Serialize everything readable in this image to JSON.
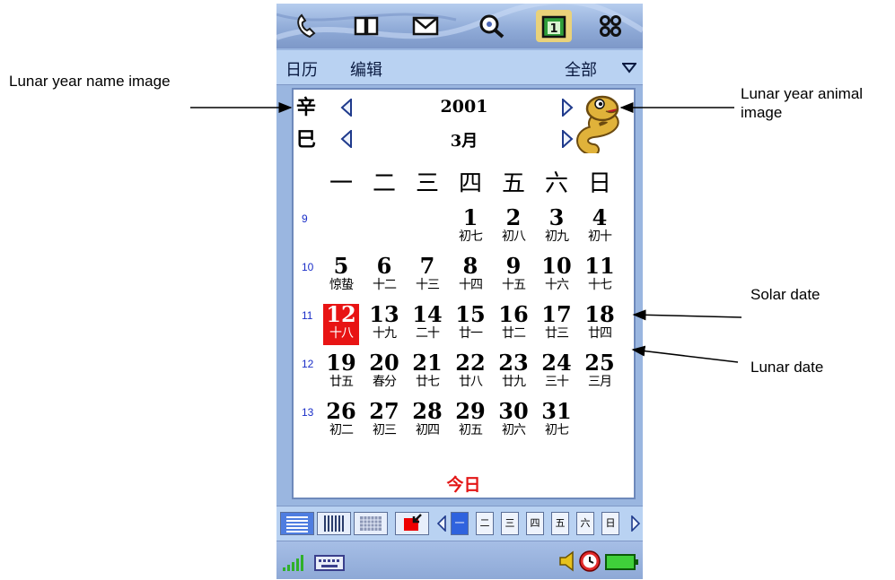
{
  "annotations": {
    "lunar_year_name": "Lunar year name image",
    "lunar_year_animal": "Lunar year animal image",
    "solar_date": "Solar date",
    "lunar_date": "Lunar date"
  },
  "topbar": {
    "icons": [
      "phone-icon",
      "contacts-book-icon",
      "messages-envelope-icon",
      "web-search-icon",
      "calendar-icon",
      "apps-grid-icon"
    ],
    "calendar_icon_digit": "1"
  },
  "menu": {
    "calendar": "日历",
    "edit": "编辑",
    "filter": "全部"
  },
  "year_panel": {
    "stem": "辛",
    "branch": "巳",
    "year": "2001",
    "month": "3月",
    "animal_icon": "snake-icon"
  },
  "weekdays": [
    "一",
    "二",
    "三",
    "四",
    "五",
    "六",
    "日"
  ],
  "weeks": [
    {
      "num": "9",
      "days": [
        null,
        null,
        null,
        {
          "s": "1",
          "l": "初七"
        },
        {
          "s": "2",
          "l": "初八"
        },
        {
          "s": "3",
          "l": "初九"
        },
        {
          "s": "4",
          "l": "初十"
        }
      ]
    },
    {
      "num": "10",
      "days": [
        {
          "s": "5",
          "l": "惊蛰"
        },
        {
          "s": "6",
          "l": "十二"
        },
        {
          "s": "7",
          "l": "十三"
        },
        {
          "s": "8",
          "l": "十四"
        },
        {
          "s": "9",
          "l": "十五"
        },
        {
          "s": "10",
          "l": "十六"
        },
        {
          "s": "11",
          "l": "十七"
        }
      ]
    },
    {
      "num": "11",
      "days": [
        {
          "s": "12",
          "l": "十八",
          "today": true
        },
        {
          "s": "13",
          "l": "十九"
        },
        {
          "s": "14",
          "l": "二十"
        },
        {
          "s": "15",
          "l": "廿一"
        },
        {
          "s": "16",
          "l": "廿二"
        },
        {
          "s": "17",
          "l": "廿三"
        },
        {
          "s": "18",
          "l": "廿四"
        }
      ]
    },
    {
      "num": "12",
      "days": [
        {
          "s": "19",
          "l": "廿五"
        },
        {
          "s": "20",
          "l": "春分"
        },
        {
          "s": "21",
          "l": "廿七"
        },
        {
          "s": "22",
          "l": "廿八"
        },
        {
          "s": "23",
          "l": "廿九"
        },
        {
          "s": "24",
          "l": "三十"
        },
        {
          "s": "25",
          "l": "三月"
        }
      ]
    },
    {
      "num": "13",
      "days": [
        {
          "s": "26",
          "l": "初二"
        },
        {
          "s": "27",
          "l": "初三"
        },
        {
          "s": "28",
          "l": "初四"
        },
        {
          "s": "29",
          "l": "初五"
        },
        {
          "s": "30",
          "l": "初六"
        },
        {
          "s": "31",
          "l": "初七"
        },
        null
      ]
    }
  ],
  "today_label": "今日",
  "toolbar": {
    "view_icons": [
      "day-view-icon",
      "week-view-icon",
      "month-view-icon",
      "go-to-date-icon"
    ],
    "weekday_buttons": [
      "一",
      "二",
      "三",
      "四",
      "五",
      "六",
      "日"
    ],
    "selected_weekday": "一"
  },
  "status": {
    "icons": [
      "signal-strength-icon",
      "keyboard-icon",
      "volume-icon",
      "alarm-clock-icon",
      "battery-icon"
    ]
  },
  "colors": {
    "today": "#e81414",
    "today_label": "#e31616",
    "week_number": "#1a2ec8",
    "selected_tool": "#2f63de"
  }
}
